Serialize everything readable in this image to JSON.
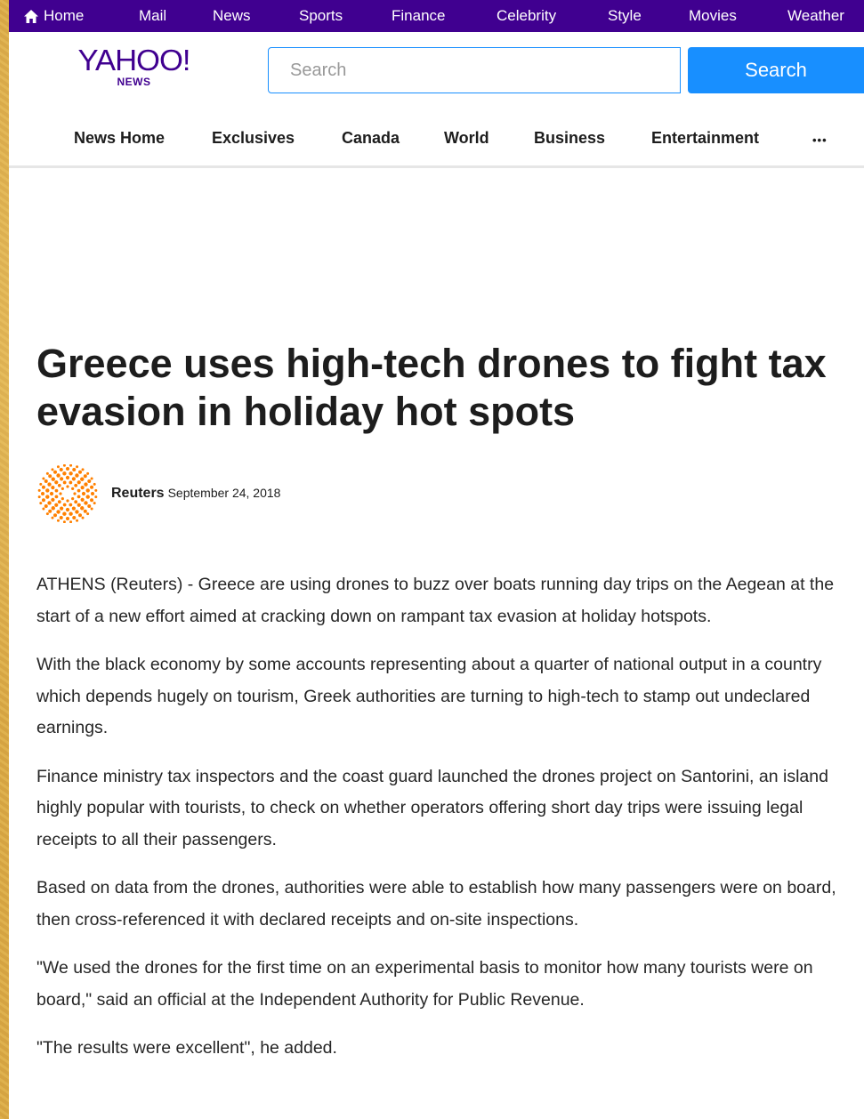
{
  "topnav": {
    "items": [
      {
        "label": "Home",
        "icon": "home-icon"
      },
      {
        "label": "Mail"
      },
      {
        "label": "News"
      },
      {
        "label": "Sports"
      },
      {
        "label": "Finance"
      },
      {
        "label": "Celebrity"
      },
      {
        "label": "Style"
      },
      {
        "label": "Movies"
      },
      {
        "label": "Weather"
      }
    ],
    "background": "#400090"
  },
  "header": {
    "logo_main": "YAHOO!",
    "logo_sub": "NEWS",
    "logo_color": "#400090",
    "search_placeholder": "Search",
    "search_button": "Search",
    "search_button_color": "#188fff"
  },
  "subnav": {
    "items": [
      "News Home",
      "Exclusives",
      "Canada",
      "World",
      "Business",
      "Entertainment",
      "•••"
    ]
  },
  "article": {
    "headline": "Greece uses high-tech drones to fight tax evasion in holiday hot spots",
    "provider": "Reuters",
    "provider_logo_icon": "reuters-logo-icon",
    "provider_logo_color": "#ff8000",
    "date": "September 24, 2018",
    "paragraphs": [
      "ATHENS (Reuters) - Greece are using drones to buzz over boats running day trips on the Aegean at the start of a new effort aimed at cracking down on rampant tax evasion at holiday hotspots.",
      "With the black economy by some accounts representing about a quarter of national output in a country which depends hugely on tourism, Greek authorities are turning to high-tech to stamp out undeclared earnings.",
      "Finance ministry tax inspectors and the coast guard launched the drones project on Santorini, an island highly popular with tourists, to check on whether operators offering short day trips were issuing legal receipts to all their passengers.",
      "Based on data from the drones, authorities were able to establish how many passengers were on board, then cross-referenced it with declared receipts and on-site inspections.",
      "\"We used the drones for the first time on an experimental basis to monitor how many tourists were on board,\" said an official at the Independent Authority for Public Revenue.",
      "\"The results were excellent\", he added."
    ]
  }
}
